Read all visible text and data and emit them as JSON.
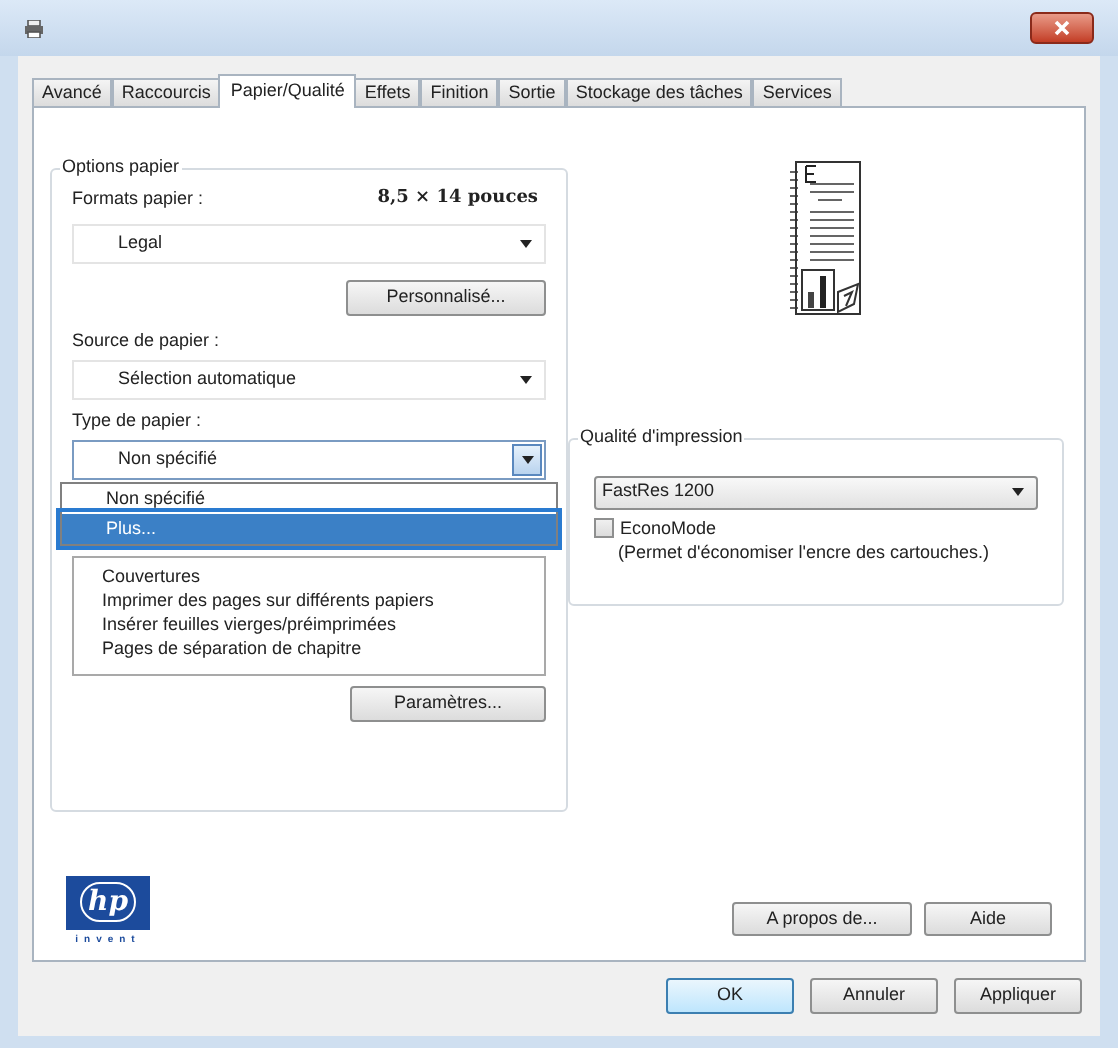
{
  "tabs": [
    {
      "label": "Avancé",
      "selected": false
    },
    {
      "label": "Raccourcis",
      "selected": false
    },
    {
      "label": "Papier/Qualité",
      "selected": true
    },
    {
      "label": "Effets",
      "selected": false
    },
    {
      "label": "Finition",
      "selected": false
    },
    {
      "label": "Sortie",
      "selected": false
    },
    {
      "label": "Stockage des tâches",
      "selected": false
    },
    {
      "label": "Services",
      "selected": false
    }
  ],
  "paper_options": {
    "legend": "Options papier",
    "formats_label": "Formats papier :",
    "formats_size": "8,5 × 14 pouces",
    "formats_value": "Legal",
    "custom_button": "Personnalisé...",
    "source_label": "Source de papier :",
    "source_value": "Sélection automatique",
    "type_label": "Type de papier :",
    "type_value": "Non spécifié",
    "type_list": [
      {
        "label": "Non spécifié",
        "selected": false
      },
      {
        "label": "Plus...",
        "selected": true
      }
    ],
    "special_pages": [
      "Couvertures",
      "Imprimer des pages sur différents papiers",
      "Insérer feuilles vierges/préimprimées",
      "Pages de séparation de chapitre"
    ],
    "settings_button": "Paramètres..."
  },
  "print_quality": {
    "legend": "Qualité d'impression",
    "value": "FastRes 1200",
    "economode": {
      "label": "EconoMode",
      "description": "(Permet d'économiser l'encre des cartouches.)",
      "checked": false
    }
  },
  "logo": {
    "mark": "hp",
    "tagline": "invent"
  },
  "panel_buttons": [
    "A propos de...",
    "Aide"
  ],
  "dialog_buttons": [
    {
      "label": "OK",
      "kind": "default"
    },
    {
      "label": "Annuler",
      "kind": "normal"
    },
    {
      "label": "Appliquer",
      "kind": "normal"
    }
  ]
}
